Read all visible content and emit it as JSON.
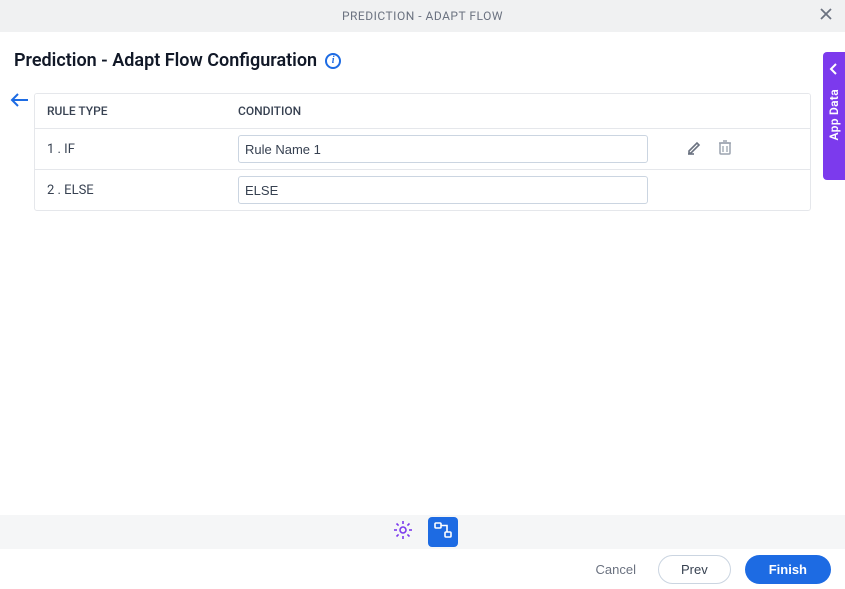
{
  "header": {
    "title": "PREDICTION - ADAPT FLOW"
  },
  "page": {
    "title": "Prediction - Adapt Flow Configuration"
  },
  "table": {
    "col_ruletype": "RULE TYPE",
    "col_condition": "CONDITION",
    "rows": [
      {
        "rule_type": "1 . IF",
        "condition": "Rule Name 1",
        "has_actions": true
      },
      {
        "rule_type": "2 . ELSE",
        "condition": "ELSE",
        "has_actions": false
      }
    ]
  },
  "side_tab": {
    "label": "App Data"
  },
  "footer": {
    "cancel": "Cancel",
    "prev": "Prev",
    "finish": "Finish"
  }
}
